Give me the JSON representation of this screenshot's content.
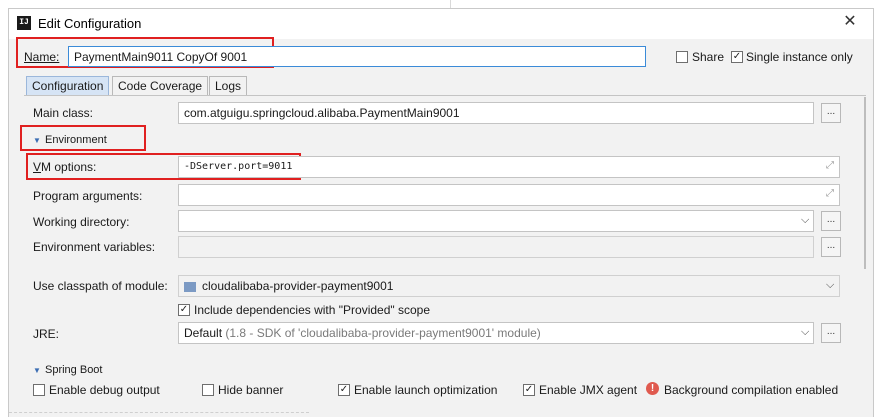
{
  "window": {
    "title": "Edit Configuration",
    "app_icon_text": "IJ"
  },
  "name_row": {
    "label": "Name:",
    "value": "PaymentMain9011 CopyOf 9001",
    "share_label": "Share",
    "share_checked": false,
    "single_instance_label": "Single instance only",
    "single_instance_checked": true
  },
  "tabs": [
    {
      "label": "Configuration",
      "active": true
    },
    {
      "label": "Code Coverage",
      "active": false
    },
    {
      "label": "Logs",
      "active": false
    }
  ],
  "main_class": {
    "label": "Main class:",
    "value": "com.atguigu.springcloud.alibaba.PaymentMain9001",
    "button": "..."
  },
  "environment": {
    "label": "Environment"
  },
  "vm_options": {
    "label": "VM options:",
    "value": "-DServer.port=9011"
  },
  "program_arguments": {
    "label": "Program arguments:",
    "value": ""
  },
  "working_directory": {
    "label": "Working directory:",
    "value": "",
    "button": "..."
  },
  "environment_variables": {
    "label": "Environment variables:",
    "value": "",
    "button": "..."
  },
  "classpath": {
    "label": "Use classpath of module:",
    "value": "cloudalibaba-provider-payment9001"
  },
  "include_deps": {
    "label": "Include dependencies with \"Provided\" scope",
    "checked": true
  },
  "jre": {
    "label": "JRE:",
    "value_main": "Default",
    "value_detail": " (1.8 - SDK of 'cloudalibaba-provider-payment9001' module)",
    "button": "..."
  },
  "spring_boot": {
    "label": "Spring Boot",
    "options": [
      {
        "label": "Enable debug output",
        "checked": false
      },
      {
        "label": "Hide banner",
        "checked": false
      },
      {
        "label": "Enable launch optimization",
        "checked": true
      },
      {
        "label": "Enable JMX agent",
        "checked": true
      }
    ],
    "warning": "Background compilation enabled"
  },
  "colors": {
    "highlight": "#e02020",
    "active_tab": "#d6e4f5",
    "focus_border": "#3b8bd8"
  },
  "icons": {
    "close": "close-icon",
    "collapse": "triangle-down-icon",
    "expand": "expand-field-icon",
    "dropdown": "chevron-down-icon",
    "warning": "warning-icon",
    "module": "module-icon"
  }
}
